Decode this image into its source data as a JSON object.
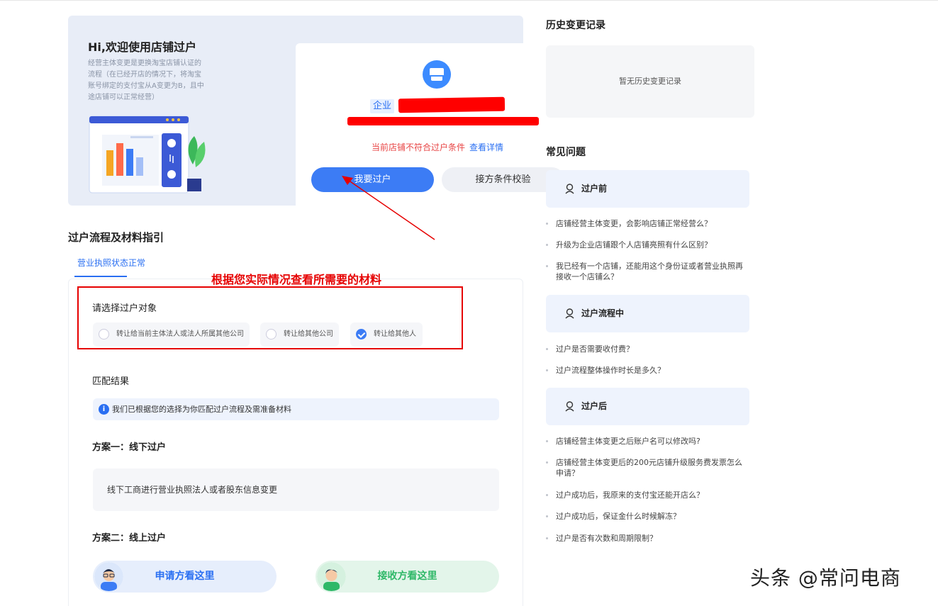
{
  "hero": {
    "title": "Hi,欢迎使用店铺过户",
    "description": "经营主体变更是更换淘宝店铺认证的流程（在已经开店的情况下，将淘宝账号绑定的支付宝从A变更为B，且中途店铺可以正常经营）",
    "enterprise_badge": "企业",
    "warning_text": "当前店铺不符合过户条件",
    "detail_link": "查看详情",
    "transfer_button": "我要过户",
    "check_button": "接方条件校验"
  },
  "flow": {
    "title": "过户流程及材料指引",
    "tab": "营业执照状态正常",
    "annotation": "根据您实际情况查看所需要的材料",
    "select_label": "请选择过户对象",
    "options": [
      {
        "label": "转让给当前主体法人或法人所属其他公司",
        "checked": false
      },
      {
        "label": "转让给其他公司",
        "checked": false
      },
      {
        "label": "转让给其他人",
        "checked": true
      }
    ],
    "match_title": "匹配结果",
    "info_icon": "i",
    "info_text": "我们已根据您的选择为你匹配过户流程及需准备材料",
    "plan1_title": "方案一：线下过户",
    "plan1_text": "线下工商进行营业执照法人或者股东信息变更",
    "plan2_title": "方案二：线上过户",
    "applicant_button": "申请方看这里",
    "receiver_button": "接收方看这里"
  },
  "history": {
    "title": "历史变更记录",
    "empty": "暂无历史变更记录"
  },
  "faq": {
    "title": "常见问题",
    "groups": [
      {
        "label": "过户前",
        "questions": [
          "店铺经营主体变更，会影响店铺正常经营么？",
          "升级为企业店铺跟个人店铺亮照有什么区别？",
          "我已经有一个店铺，还能用这个身份证或者营业执照再接收一个店铺么？"
        ]
      },
      {
        "label": "过户流程中",
        "questions": [
          "过户是否需要收付费？",
          "过户流程整体操作时长是多久？"
        ]
      },
      {
        "label": "过户后",
        "questions": [
          "店铺经营主体变更之后账户名可以修改吗?",
          "店铺经营主体变更后的200元店铺升级服务费发票怎么申请？",
          "过户成功后，我原来的支付宝还能开店么？",
          "过户成功后，保证金什么时候解冻？",
          "过户是否有次数和周期限制？"
        ]
      }
    ]
  },
  "watermark": "头条 @常问电商",
  "colors": {
    "primary": "#3c7cf5",
    "annotation_red": "#e60000",
    "success_green": "#2fb868"
  }
}
